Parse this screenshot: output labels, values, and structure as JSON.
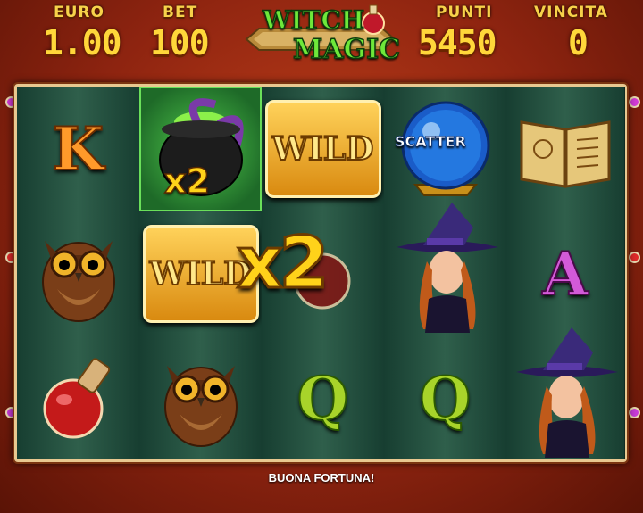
{
  "header": {
    "currency_label": "EURO",
    "currency_value": "1.00",
    "bet_label": "BET",
    "bet_value": "100",
    "points_label": "PUNTI",
    "points_value": "5450",
    "win_label": "VINCITA",
    "win_value": "0"
  },
  "logo": {
    "line1": "Witch",
    "line2": "Magic"
  },
  "reels": [
    [
      "king",
      "owl",
      "potion"
    ],
    [
      "cauldron-x2",
      "wild",
      "owl"
    ],
    [
      "wild",
      "multiplier-x2",
      "queen"
    ],
    [
      "scatter",
      "witch",
      "queen"
    ],
    [
      "spellbook",
      "ace",
      "witch"
    ]
  ],
  "symbols": {
    "king": "K",
    "ace": "A",
    "queen": "Q",
    "wild": "WILD",
    "scatter": "SCATTER",
    "cauldron_mult": "x2",
    "big_mult": "x2"
  },
  "footer": {
    "message": "BUONA FORTUNA!"
  },
  "colors": {
    "gold": "#ffd73a",
    "felt": "#1f4b3a",
    "frame_red": "#8e2410"
  }
}
